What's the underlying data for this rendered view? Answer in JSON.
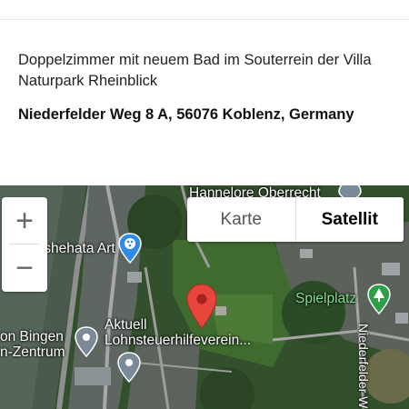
{
  "listing": {
    "description": "Doppelzimmer mit neuem Bad im Souterrein der Villa Naturpark Rheinblick",
    "address": "Niederfelder Weg 8 A, 56076 Koblenz, Germany"
  },
  "map": {
    "zoom_in": "+",
    "zoom_out": "−",
    "type_toggle": {
      "map_label": "Karte",
      "satellite_label": "Satellit",
      "selected": "Satellit"
    },
    "labels": {
      "hannelore": "Hannelore Oberrecht",
      "art": "Ishehata Art",
      "spielplatz": "Spielplatz",
      "bingen_line1": "on Bingen",
      "bingen_line2": "n-Zentrum",
      "aktuell_line1": "Aktuell",
      "aktuell_line2": "Lohnsteuerhilfeverein...",
      "street": "Niederfelder W"
    },
    "colors": {
      "pin_red": "#e8453c",
      "park_green": "#2e9e48",
      "poi_gray": "#7a8a99",
      "art_blue": "#2f8ae8"
    }
  }
}
